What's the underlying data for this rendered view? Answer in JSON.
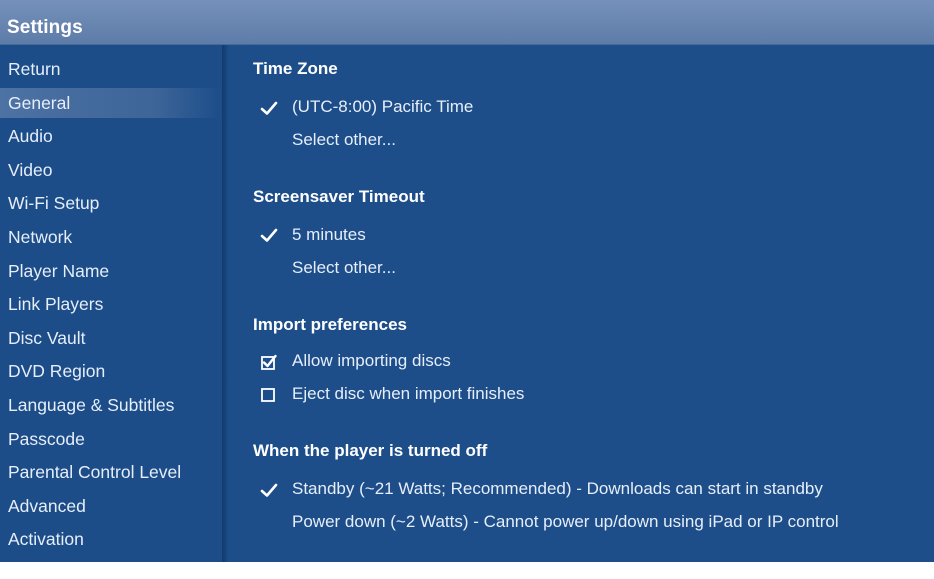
{
  "window": {
    "title": "Settings"
  },
  "sidebar": {
    "items": [
      {
        "label": "Return",
        "name": "sidebar-item-return"
      },
      {
        "label": "General",
        "name": "sidebar-item-general",
        "selected": true
      },
      {
        "label": "Audio",
        "name": "sidebar-item-audio"
      },
      {
        "label": "Video",
        "name": "sidebar-item-video"
      },
      {
        "label": "Wi-Fi Setup",
        "name": "sidebar-item-wifi-setup"
      },
      {
        "label": "Network",
        "name": "sidebar-item-network"
      },
      {
        "label": "Player Name",
        "name": "sidebar-item-player-name"
      },
      {
        "label": "Link Players",
        "name": "sidebar-item-link-players"
      },
      {
        "label": "Disc Vault",
        "name": "sidebar-item-disc-vault"
      },
      {
        "label": "DVD Region",
        "name": "sidebar-item-dvd-region"
      },
      {
        "label": "Language & Subtitles",
        "name": "sidebar-item-language-subtitles"
      },
      {
        "label": "Passcode",
        "name": "sidebar-item-passcode"
      },
      {
        "label": "Parental Control Level",
        "name": "sidebar-item-parental-control-level"
      },
      {
        "label": "Advanced",
        "name": "sidebar-item-advanced"
      },
      {
        "label": "Activation",
        "name": "sidebar-item-activation"
      }
    ]
  },
  "main": {
    "time_zone": {
      "title": "Time Zone",
      "current": "(UTC-8:00) Pacific Time",
      "select_other": "Select other..."
    },
    "screensaver": {
      "title": "Screensaver Timeout",
      "current": "5 minutes",
      "select_other": "Select other..."
    },
    "import": {
      "title": "Import preferences",
      "allow_importing": {
        "label": "Allow importing discs",
        "checked": true
      },
      "eject_disc": {
        "label": "Eject disc when import finishes",
        "checked": false
      }
    },
    "power": {
      "title": "When the player is turned off",
      "standby": "Standby (~21 Watts; Recommended) - Downloads can start in standby",
      "power_down": "Power down (~2 Watts) - Cannot power up/down using iPad or IP control",
      "selected": "standby"
    }
  },
  "colors": {
    "background": "#1d4e8a",
    "titlebar": "#6a87b2",
    "selection": "#4a70a2",
    "text": "#e6eef9"
  },
  "icons": {
    "checkmark": "check-icon",
    "checkbox_checked": "checkbox-checked-icon",
    "checkbox_unchecked": "checkbox-unchecked-icon"
  }
}
